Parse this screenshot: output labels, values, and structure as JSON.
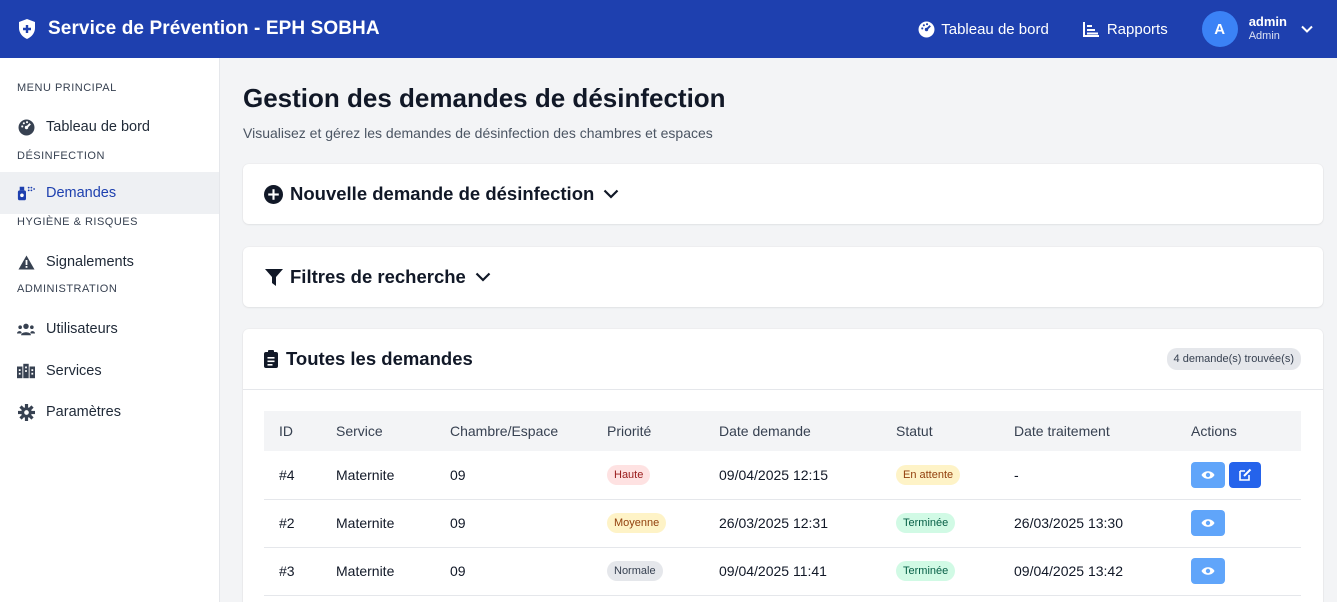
{
  "header": {
    "title": "Service de Prévention - EPH SOBHA",
    "nav": [
      {
        "label": "Tableau de bord",
        "icon": "dashboard-icon"
      },
      {
        "label": "Rapports",
        "icon": "chart-icon"
      }
    ],
    "user": {
      "initial": "A",
      "name": "admin",
      "role": "Admin"
    }
  },
  "sidebar": {
    "sections": [
      {
        "title": "MENU PRINCIPAL",
        "items": [
          {
            "label": "Tableau de bord",
            "icon": "dashboard-icon"
          }
        ]
      },
      {
        "title": "DÉSINFECTION",
        "items": [
          {
            "label": "Demandes",
            "icon": "disinfect-icon",
            "active": true
          }
        ]
      },
      {
        "title": "HYGIÈNE & RISQUES",
        "items": [
          {
            "label": "Signalements",
            "icon": "warning-icon"
          }
        ]
      },
      {
        "title": "ADMINISTRATION",
        "items": [
          {
            "label": "Utilisateurs",
            "icon": "users-icon"
          },
          {
            "label": "Services",
            "icon": "building-icon"
          },
          {
            "label": "Paramètres",
            "icon": "gear-icon"
          }
        ]
      }
    ]
  },
  "main": {
    "title": "Gestion des demandes de désinfection",
    "subtitle": "Visualisez et gérez les demandes de désinfection des chambres et espaces",
    "new_request": "Nouvelle demande de désinfection",
    "filters": "Filtres de recherche",
    "list": {
      "title": "Toutes les demandes",
      "count": "4 demande(s) trouvée(s)",
      "columns": [
        "ID",
        "Service",
        "Chambre/Espace",
        "Priorité",
        "Date demande",
        "Statut",
        "Date traitement",
        "Actions"
      ],
      "rows": [
        {
          "id": "#4",
          "service": "Maternite",
          "room": "09",
          "priority": "Haute",
          "date": "09/04/2025 12:15",
          "status": "En attente",
          "processed": "-"
        },
        {
          "id": "#2",
          "service": "Maternite",
          "room": "09",
          "priority": "Moyenne",
          "date": "26/03/2025 12:31",
          "status": "Terminée",
          "processed": "26/03/2025 13:30"
        },
        {
          "id": "#3",
          "service": "Maternite",
          "room": "09",
          "priority": "Normale",
          "date": "09/04/2025 11:41",
          "status": "Terminée",
          "processed": "09/04/2025 13:42"
        }
      ]
    }
  },
  "colors": {
    "primary": "#1e40af",
    "accent": "#3b82f6",
    "view_button": "#60a5fa",
    "edit_button": "#2563eb"
  }
}
